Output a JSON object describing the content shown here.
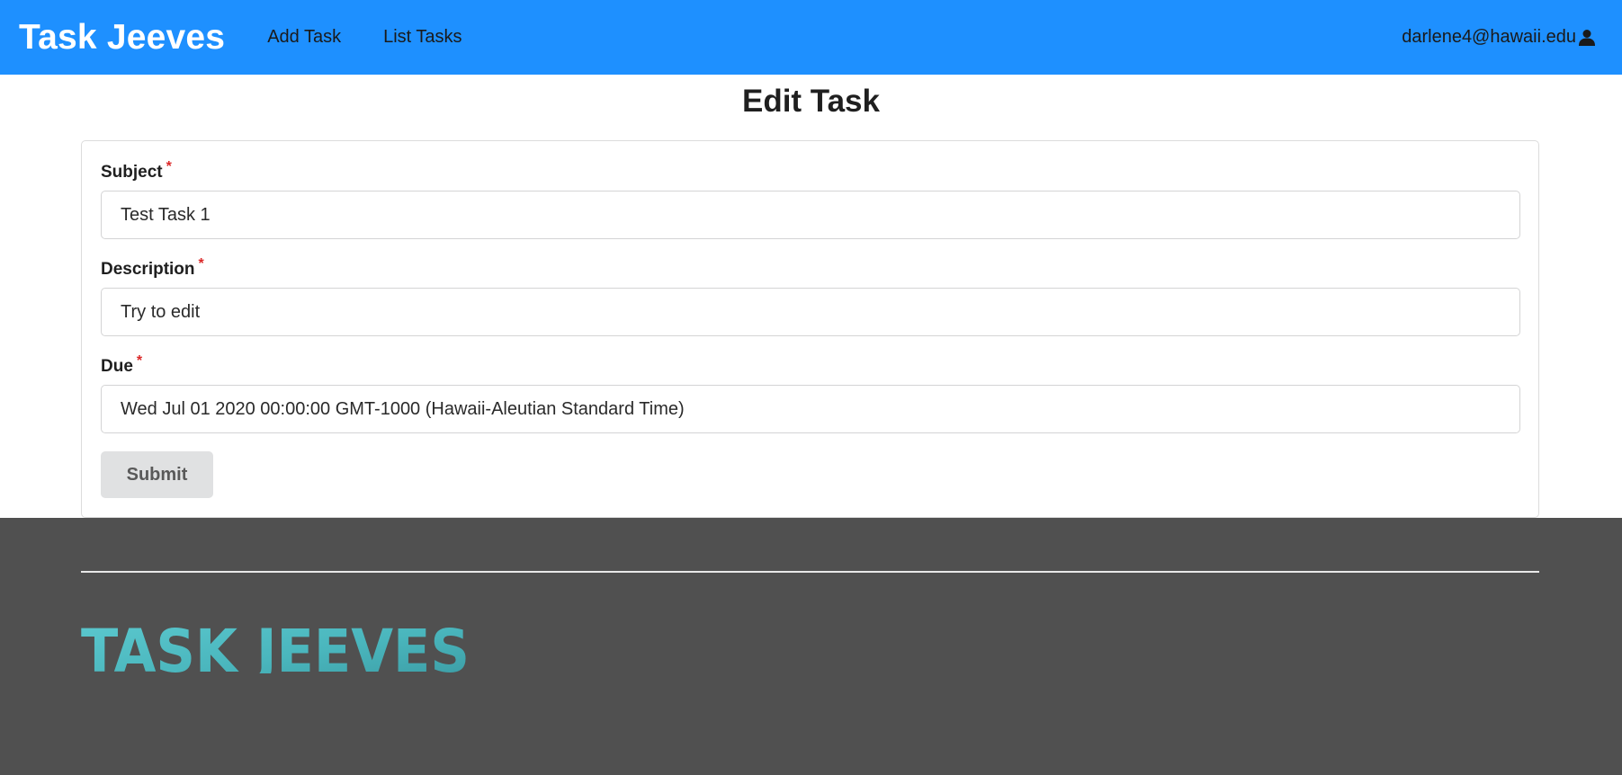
{
  "navbar": {
    "brand": "Task Jeeves",
    "links": [
      {
        "label": "Add Task"
      },
      {
        "label": "List Tasks"
      }
    ],
    "user_email": "darlene4@hawaii.edu",
    "user_icon": "user-icon",
    "background_color": "#1e90ff"
  },
  "page": {
    "title": "Edit Task"
  },
  "form": {
    "fields": [
      {
        "label": "Subject",
        "required_mark": "*",
        "value": "Test Task 1"
      },
      {
        "label": "Description",
        "required_mark": "*",
        "value": "Try to edit"
      },
      {
        "label": "Due",
        "required_mark": "*",
        "value": "Wed Jul 01 2020 00:00:00 GMT-1000 (Hawaii-Aleutian Standard Time)"
      }
    ],
    "submit_label": "Submit"
  },
  "footer": {
    "logo_text": "TASK JEEVES",
    "logo_color": "#4fc0c6",
    "background_color": "#505050"
  }
}
